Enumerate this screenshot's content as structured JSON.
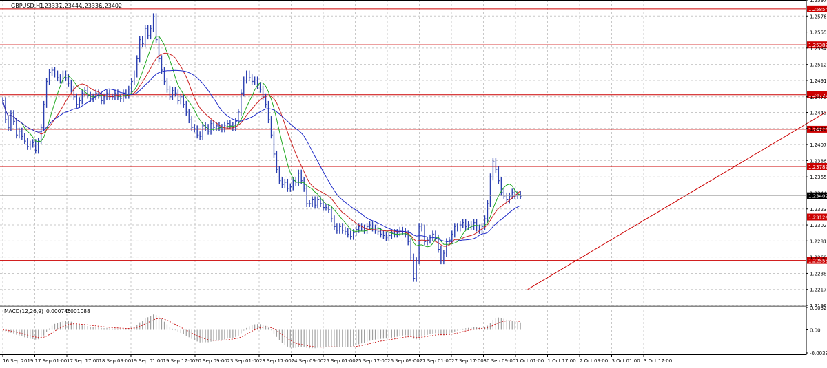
{
  "chart_data": {
    "type": "candlestick",
    "symbol_label": "GBPUSD,H1",
    "ohlc_header": {
      "open": "1.23337",
      "high": "1.23444",
      "low": "1.23336",
      "close": "1.23402"
    },
    "last_price": "1.23402",
    "grid": true,
    "price_axis": {
      "ticks": [
        "1.25970",
        "1.25760",
        "1.25550",
        "1.25340",
        "1.25125",
        "1.24915",
        "1.24700",
        "1.24495",
        "1.24285",
        "1.24075",
        "1.23865",
        "1.23650",
        "1.23440",
        "1.23230",
        "1.23020",
        "1.22810",
        "1.22600",
        "1.22385",
        "1.22175",
        "1.21965"
      ],
      "range": [
        1.21965,
        1.2597
      ]
    },
    "time_axis": {
      "labels": [
        "16 Sep 2019",
        "17 Sep 01:00",
        "17 Sep 17:00",
        "18 Sep 09:00",
        "19 Sep 01:00",
        "19 Sep 17:00",
        "20 Sep 09:00",
        "23 Sep 01:00",
        "23 Sep 17:00",
        "24 Sep 09:00",
        "25 Sep 01:00",
        "25 Sep 17:00",
        "26 Sep 09:00",
        "27 Sep 01:00",
        "27 Sep 17:00",
        "30 Sep 09:00",
        "1 Oct 01:00",
        "1 Oct 17:00",
        "2 Oct 09:00",
        "3 Oct 01:00",
        "3 Oct 17:00"
      ]
    },
    "horizontal_levels": [
      "1.25854",
      "1.25382",
      "1.24727",
      "1.24275",
      "1.23787",
      "1.23124",
      "1.22555"
    ],
    "level_color": "#cc0000",
    "price_series": {
      "x": [
        0,
        2,
        4,
        6,
        8,
        10,
        12,
        14,
        16,
        18,
        20,
        22,
        24,
        26,
        28,
        30,
        32,
        34,
        36,
        38,
        40,
        42,
        44,
        46,
        48,
        50,
        52,
        54,
        56,
        58,
        60,
        62,
        64,
        66,
        68,
        70,
        72,
        74,
        76,
        78,
        80,
        82,
        84,
        86,
        88,
        90,
        92,
        94,
        96,
        98,
        100,
        102,
        104,
        106,
        108,
        110,
        112,
        114,
        116,
        118,
        120,
        122,
        124,
        126,
        128,
        130,
        132,
        134,
        136,
        138,
        140,
        142,
        144,
        146,
        148,
        150,
        152,
        154,
        156,
        158,
        160,
        162,
        164,
        166,
        168,
        170,
        172,
        174,
        176,
        178,
        180,
        182,
        184,
        186,
        188,
        190,
        192,
        194,
        196,
        198,
        200,
        202,
        204,
        206,
        208,
        210,
        212,
        214,
        216,
        218,
        220,
        222,
        224,
        226,
        228,
        230,
        232,
        234,
        236,
        238,
        240,
        242,
        244,
        246,
        248,
        250,
        252,
        254,
        256,
        258,
        260,
        262,
        264,
        266,
        268,
        270,
        272,
        274,
        276,
        278,
        280,
        282,
        284,
        286,
        288,
        290,
        292,
        294,
        296,
        298,
        300,
        302,
        304,
        306,
        308,
        310,
        312,
        314,
        316,
        318,
        320,
        322,
        324,
        326,
        328,
        330,
        332,
        334,
        336,
        338,
        340,
        342,
        344,
        346,
        348,
        350,
        352,
        354,
        356,
        358,
        360,
        362,
        364,
        366,
        368,
        370,
        372,
        374,
        376,
        378,
        380,
        382,
        384,
        386,
        388,
        390,
        392,
        394,
        396,
        398,
        400,
        402,
        404,
        406,
        408,
        410,
        412,
        414,
        416,
        418,
        420,
        422,
        424,
        426,
        428,
        430,
        432,
        434,
        436,
        438,
        440,
        442,
        444,
        446,
        448,
        450,
        452,
        454,
        456,
        458,
        460,
        462,
        464,
        466,
        468
      ],
      "y": [
        1.2465,
        1.244,
        1.243,
        1.2448,
        1.2438,
        1.242,
        1.2425,
        1.2418,
        1.2412,
        1.2405,
        1.2408,
        1.241,
        1.24,
        1.2412,
        1.243,
        1.246,
        1.249,
        1.2502,
        1.2505,
        1.25,
        1.2495,
        1.2492,
        1.25,
        1.2495,
        1.2488,
        1.248,
        1.247,
        1.246,
        1.2465,
        1.2475,
        1.2478,
        1.2472,
        1.2468,
        1.247,
        1.2475,
        1.2472,
        1.2465,
        1.247,
        1.2475,
        1.247,
        1.247,
        1.2475,
        1.247,
        1.2468,
        1.2475,
        1.2472,
        1.248,
        1.249,
        1.25,
        1.252,
        1.2545,
        1.254,
        1.256,
        1.255,
        1.256,
        1.2575,
        1.2545,
        1.252,
        1.2505,
        1.249,
        1.248,
        1.247,
        1.2478,
        1.2475,
        1.2465,
        1.247,
        1.246,
        1.245,
        1.244,
        1.243,
        1.2428,
        1.242,
        1.2418,
        1.2432,
        1.243,
        1.2425,
        1.2435,
        1.243,
        1.2432,
        1.243,
        1.2428,
        1.2433,
        1.2435,
        1.2432,
        1.243,
        1.2438,
        1.245,
        1.2475,
        1.2492,
        1.25,
        1.2495,
        1.249,
        1.2492,
        1.2485,
        1.248,
        1.247,
        1.246,
        1.244,
        1.242,
        1.2395,
        1.2375,
        1.236,
        1.2355,
        1.2358,
        1.235,
        1.2352,
        1.236,
        1.2358,
        1.237,
        1.236,
        1.235,
        1.233,
        1.233,
        1.2335,
        1.2328,
        1.2335,
        1.233,
        1.2325,
        1.2325,
        1.2322,
        1.231,
        1.23,
        1.2295,
        1.23,
        1.2295,
        1.2293,
        1.229,
        1.2287,
        1.2292,
        1.2296,
        1.23,
        1.2298,
        1.2295,
        1.23,
        1.2302,
        1.2298,
        1.2295,
        1.2293,
        1.229,
        1.2288,
        1.2285,
        1.2288,
        1.2292,
        1.229,
        1.2292,
        1.2295,
        1.2293,
        1.229,
        1.228,
        1.226,
        1.2232,
        1.2255,
        1.23,
        1.2298,
        1.228,
        1.2282,
        1.2285,
        1.229,
        1.2285,
        1.227,
        1.2255,
        1.2265,
        1.228,
        1.2282,
        1.229,
        1.23,
        1.2298,
        1.2302,
        1.2305,
        1.23,
        1.2302,
        1.23,
        1.2305,
        1.2298,
        1.2295,
        1.23,
        1.231,
        1.233,
        1.2365,
        1.2385,
        1.2375,
        1.236,
        1.2345,
        1.234,
        1.2335,
        1.234,
        1.2345,
        1.234,
        1.2342,
        1.234
      ],
      "color": "#2b3fb0"
    },
    "moving_averages": [
      {
        "color": "#22aa22",
        "period": 8
      },
      {
        "color": "#cc2222",
        "period": 14
      },
      {
        "color": "#1e2ac8",
        "period": 24
      }
    ],
    "trendline": {
      "from": {
        "x": 0.638,
        "y": 1.22175
      },
      "to": {
        "x": 0.999,
        "y": 1.245
      },
      "color": "#cc0000"
    },
    "macd": {
      "label": "MACD(12,26,9)",
      "value1": "0.000745",
      "value2": "0.001088",
      "axis_ticks": [
        "0.003222",
        "0.00",
        "-0.003322"
      ],
      "range": [
        -0.003322,
        0.003222
      ],
      "histogram_color": "#9e9e9e",
      "signal_color": "#cc2222"
    }
  }
}
